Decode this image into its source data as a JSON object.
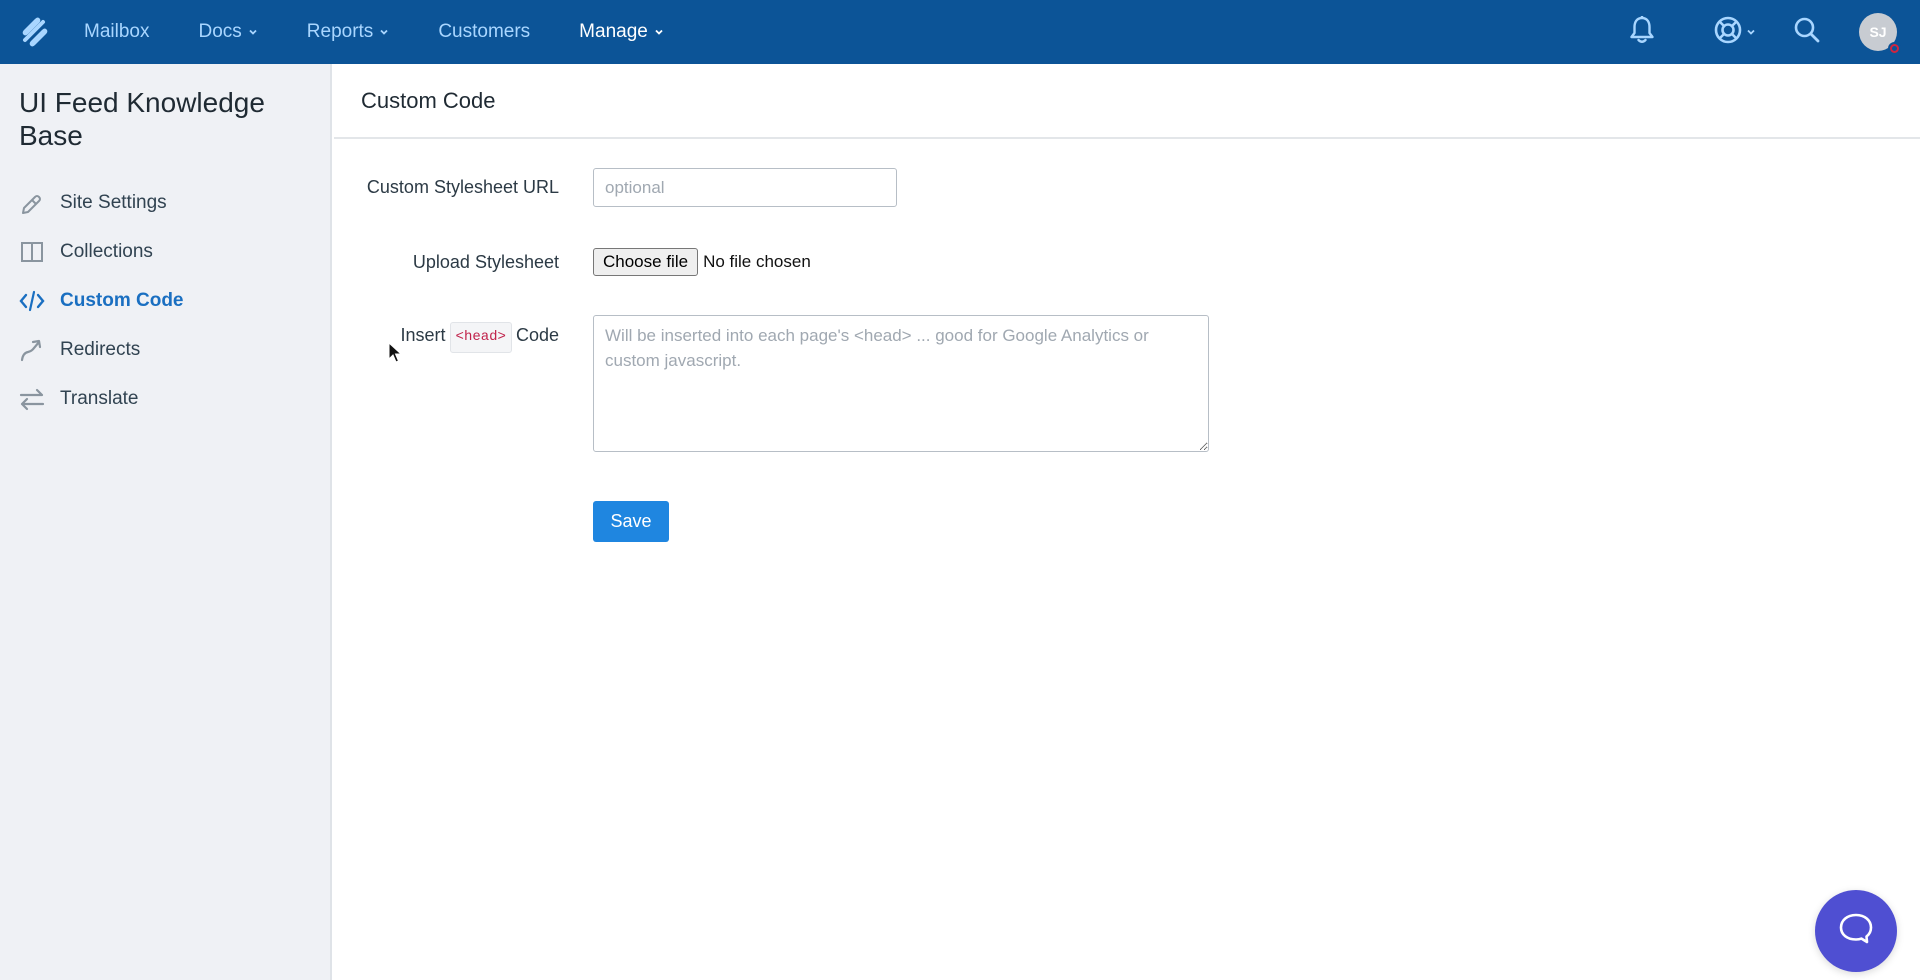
{
  "topbar": {
    "logo": "helpscout-logo-icon",
    "nav": [
      {
        "label": "Mailbox",
        "has_dropdown": false,
        "active": false
      },
      {
        "label": "Docs",
        "has_dropdown": true,
        "active": false
      },
      {
        "label": "Reports",
        "has_dropdown": true,
        "active": false
      },
      {
        "label": "Customers",
        "has_dropdown": false,
        "active": false
      },
      {
        "label": "Manage",
        "has_dropdown": true,
        "active": true
      }
    ],
    "icons": [
      "bell-icon",
      "help-lifebuoy-icon",
      "search-icon"
    ],
    "avatar_initials": "SJ",
    "colors": {
      "bar": "#0c5497",
      "nav_text": "#a9d6ff",
      "nav_active": "#ffffff",
      "status_badge": "#d0253f"
    }
  },
  "sidebar": {
    "title": "UI Feed Knowledge Base",
    "items": [
      {
        "label": "Site Settings",
        "icon": "pencil-icon",
        "active": false
      },
      {
        "label": "Collections",
        "icon": "book-icon",
        "active": false
      },
      {
        "label": "Custom Code",
        "icon": "code-icon",
        "active": true
      },
      {
        "label": "Redirects",
        "icon": "redirect-arrow-icon",
        "active": false
      },
      {
        "label": "Translate",
        "icon": "swap-arrows-icon",
        "active": false
      }
    ],
    "colors": {
      "active": "#1a6fc1"
    }
  },
  "main": {
    "title": "Custom Code",
    "stylesheet_url": {
      "label": "Custom Stylesheet URL",
      "value": "",
      "placeholder": "optional"
    },
    "upload": {
      "label": "Upload Stylesheet",
      "button": "Choose file",
      "status": "No file chosen"
    },
    "head_code": {
      "label_prefix": "Insert",
      "label_tag": "<head>",
      "label_suffix": "Code",
      "value": "",
      "placeholder": "Will be inserted into each page's <head> ... good for Google Analytics or custom javascript."
    },
    "save_label": "Save",
    "colors": {
      "save": "#1f86e0"
    }
  },
  "chat": {
    "icon": "chat-bubble-icon",
    "color": "#4f4fd2"
  }
}
